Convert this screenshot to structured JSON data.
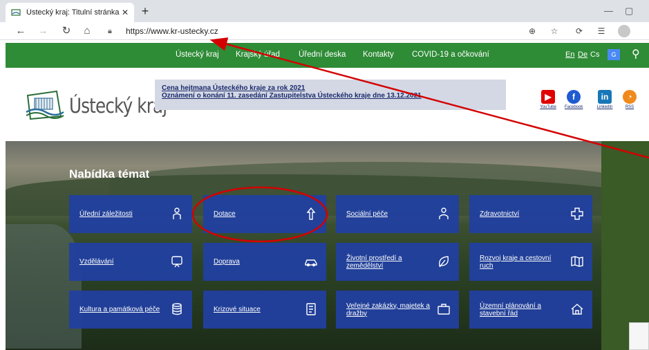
{
  "browser": {
    "tab_title": "Ústecký kraj: Titulní stránka",
    "url": "https://www.kr-ustecky.cz"
  },
  "nav": {
    "items": [
      "Ústecký kraj",
      "Krajský úřad",
      "Úřední deska",
      "Kontakty",
      "COVID-19 a očkování"
    ],
    "languages": [
      "En",
      "De",
      "Cs"
    ],
    "accent": "#2e8b36"
  },
  "header": {
    "brand": "Ústecký kraj",
    "news": [
      "Cena hejtmana Ústeckého kraje za rok 2021",
      "Oznámení o konání 11. zasedání Zastupitelstva Ústeckého kraje dne 13.12.2021"
    ],
    "social": [
      {
        "label": "YouTube",
        "icon": "youtube-icon",
        "color": "#e00000"
      },
      {
        "label": "Facebook",
        "icon": "facebook-icon",
        "color": "#1f5bd1"
      },
      {
        "label": "LinkedIn",
        "icon": "linkedin-icon",
        "color": "#1877b6"
      },
      {
        "label": "RSS",
        "icon": "rss-icon",
        "color": "#f08a1c"
      }
    ]
  },
  "hero": {
    "title": "Nabídka témat",
    "cards": [
      {
        "label": "Úřední záležitosti",
        "icon": "people-icon"
      },
      {
        "label": "Dotace",
        "icon": "hand-coin-icon"
      },
      {
        "label": "Sociální péče",
        "icon": "person-icon"
      },
      {
        "label": "Zdravotnictví",
        "icon": "medical-cross-icon"
      },
      {
        "label": "Vzdělávání",
        "icon": "chalkboard-icon"
      },
      {
        "label": "Doprava",
        "icon": "car-icon"
      },
      {
        "label": "Životní prostředí a zemědělství",
        "icon": "leaf-icon"
      },
      {
        "label": "Rozvoj kraje a cestovní ruch",
        "icon": "map-icon"
      },
      {
        "label": "Kultura a památková péče",
        "icon": "coins-icon"
      },
      {
        "label": "Krizové situace",
        "icon": "document-icon"
      },
      {
        "label": "Veřejné zakázky, majetek a dražby",
        "icon": "briefcase-icon"
      },
      {
        "label": "Územní plánování a stavební řád",
        "icon": "house-icon"
      }
    ],
    "card_color": "#2140a0"
  },
  "annotations": {
    "color": "#d40000"
  }
}
